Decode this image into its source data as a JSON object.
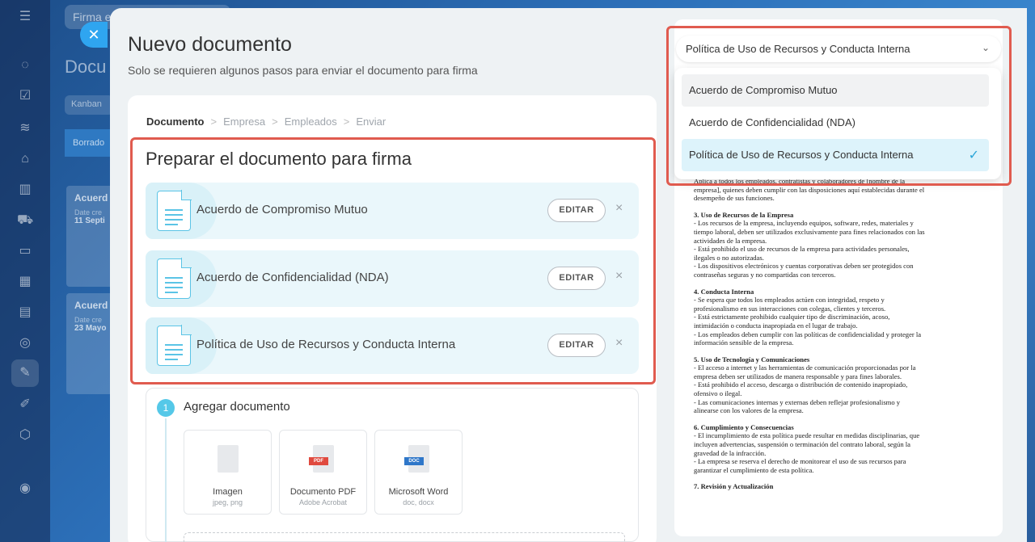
{
  "background": {
    "search_placeholder": "Firma e",
    "page_title": "Docu",
    "kanban_label": "Kanban",
    "column_label": "Borrado",
    "cards": [
      {
        "title": "Acuerd",
        "date_label": "Date cre",
        "date_value": "11 Septi"
      },
      {
        "title": "Acuerd",
        "date_label": "Date cre",
        "date_value": "23 Mayo"
      }
    ]
  },
  "modal": {
    "title": "Nuevo documento",
    "subtitle": "Solo se requieren algunos pasos para enviar el documento para firma",
    "close_icon": "close-icon"
  },
  "breadcrumb": {
    "steps": [
      "Documento",
      "Empresa",
      "Empleados",
      "Enviar"
    ],
    "separator": ">"
  },
  "prepare": {
    "title": "Preparar el documento para firma",
    "edit_label": "EDITAR",
    "remove_label": "×",
    "documents": [
      {
        "name": "Acuerdo de Compromiso Mutuo"
      },
      {
        "name": "Acuerdo de Confidencialidad (NDA)"
      },
      {
        "name": "Política de Uso de Recursos y Conducta Interna"
      }
    ]
  },
  "add_document": {
    "step_number": "1",
    "title": "Agregar documento",
    "types": [
      {
        "name": "Imagen",
        "ext": "jpeg, png",
        "badge": ""
      },
      {
        "name": "Documento PDF",
        "ext": "Adobe Acrobat",
        "badge": "PDF",
        "color": "#e04a3f"
      },
      {
        "name": "Microsoft Word",
        "ext": "doc, docx",
        "badge": "DOC",
        "color": "#2f77c9"
      }
    ]
  },
  "select": {
    "value": "Política de Uso de Recursos y Conducta Interna",
    "options": [
      "Acuerdo de Compromiso Mutuo",
      "Acuerdo de Confidencialidad (NDA)",
      "Política de Uso de Recursos y Conducta Interna"
    ]
  },
  "preview": {
    "intro": [
      "Aplica a todos los empleados, contratistas y colaboradores de [nombre de la",
      "empresa], quienes deben cumplir con las disposiciones aquí establecidas durante el",
      "desempeño de sus funciones."
    ],
    "sections": [
      {
        "heading": "3. Uso de Recursos de la Empresa",
        "lines": [
          "- Los recursos de la empresa, incluyendo equipos, software, redes, materiales y",
          "tiempo laboral, deben ser utilizados exclusivamente para fines relacionados con las",
          "actividades de la empresa.",
          "- Está prohibido el uso de recursos de la empresa para actividades personales,",
          "ilegales o no autorizadas.",
          "- Los dispositivos electrónicos y cuentas corporativas deben ser protegidos con",
          "contraseñas seguras y no compartidas con terceros."
        ]
      },
      {
        "heading": "4. Conducta Interna",
        "lines": [
          "- Se espera que todos los empleados actúen con integridad, respeto y",
          "profesionalismo en sus interacciones con colegas, clientes y terceros.",
          "- Está estrictamente prohibido cualquier tipo de discriminación, acoso,",
          "intimidación o conducta inapropiada en el lugar de trabajo.",
          "- Los empleados deben cumplir con las políticas de confidencialidad y proteger la",
          "información sensible de la empresa."
        ]
      },
      {
        "heading": "5. Uso de Tecnología y Comunicaciones",
        "lines": [
          "- El acceso a internet y las herramientas de comunicación proporcionadas por la",
          "empresa deben ser utilizados de manera responsable y para fines laborales.",
          "- Está prohibido el acceso, descarga o distribución de contenido inapropiado,",
          "ofensivo o ilegal.",
          "- Las comunicaciones internas y externas deben reflejar profesionalismo y",
          "alinearse con los valores de la empresa."
        ]
      },
      {
        "heading": "6. Cumplimiento y Consecuencias",
        "lines": [
          "- El incumplimiento de esta política puede resultar en medidas disciplinarias, que",
          "incluyen advertencias, suspensión o terminación del contrato laboral, según la",
          "gravedad de la infracción.",
          "- La empresa se reserva el derecho de monitorear el uso de sus recursos para",
          "garantizar el cumplimiento de esta política."
        ]
      },
      {
        "heading": "7. Revisión y Actualización",
        "lines": []
      }
    ]
  },
  "colors": {
    "accent": "#55c8e8",
    "highlight_border": "#e05b4f",
    "selected_option": "#ddf3fb"
  }
}
